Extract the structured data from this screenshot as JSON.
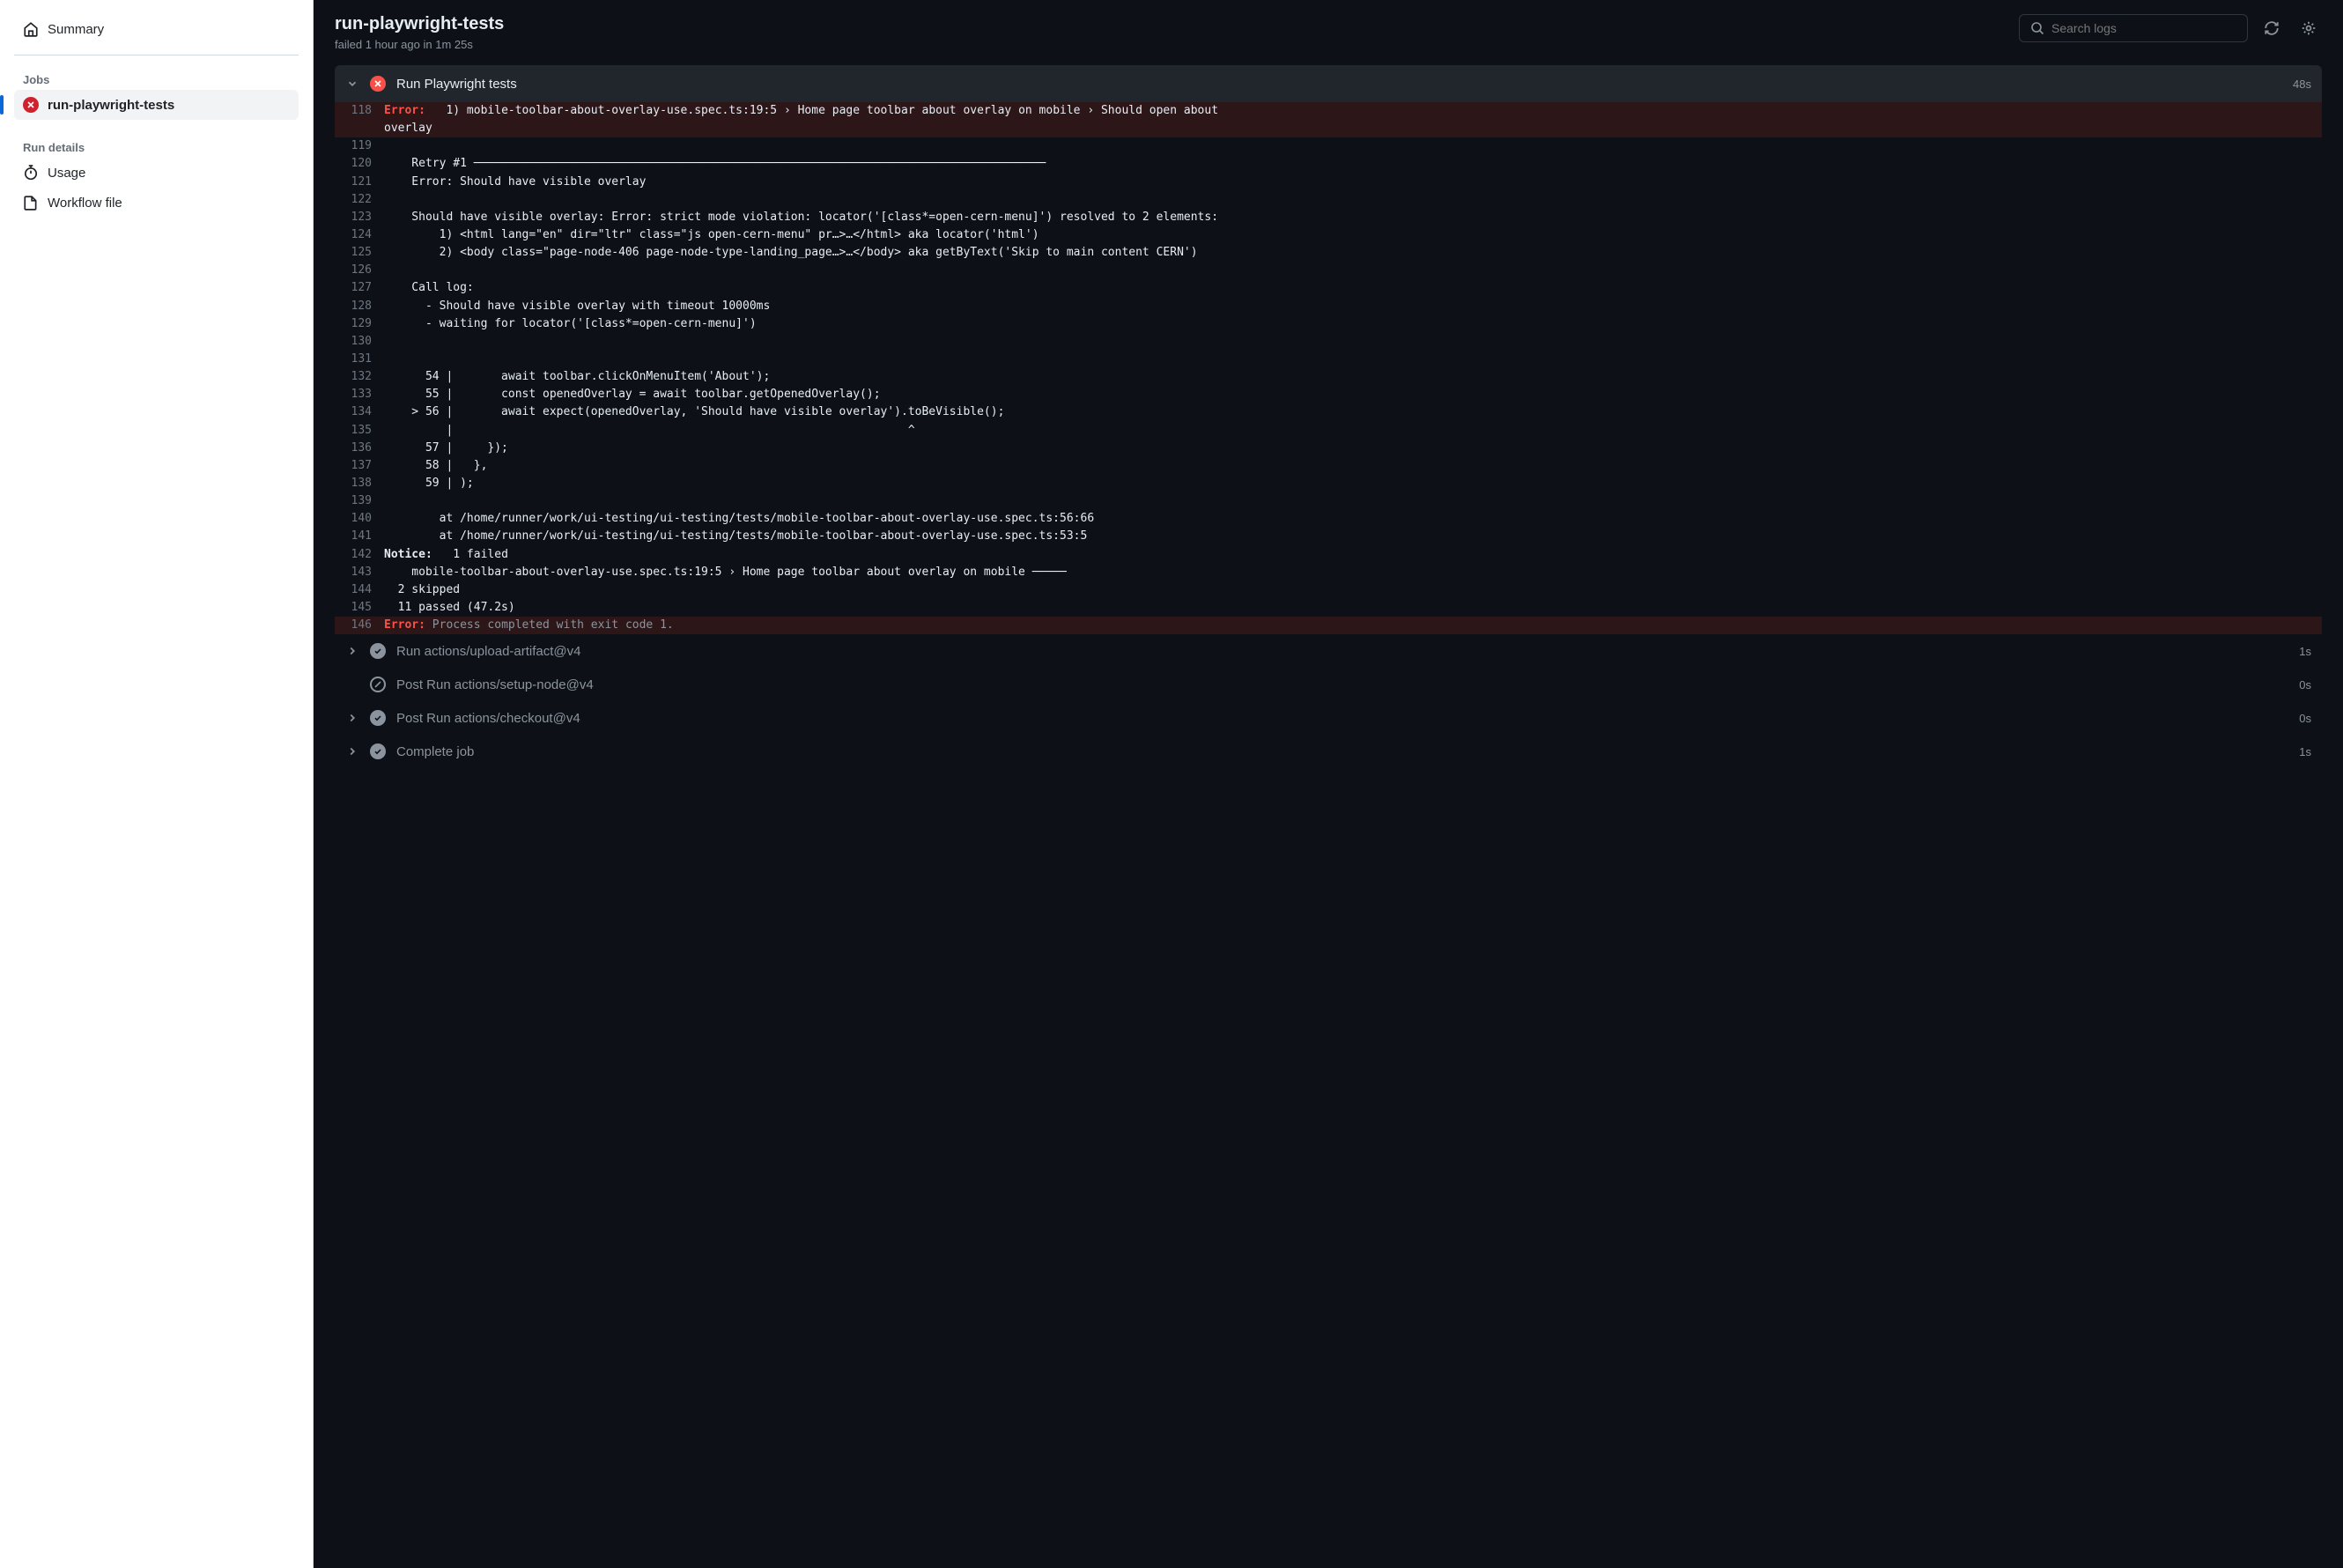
{
  "sidebar": {
    "summary": "Summary",
    "jobs_heading": "Jobs",
    "job_name": "run-playwright-tests",
    "run_details_heading": "Run details",
    "usage": "Usage",
    "workflow_file": "Workflow file"
  },
  "header": {
    "title": "run-playwright-tests",
    "status": "failed",
    "when": "1 hour ago",
    "in_word": "in",
    "duration": "1m 25s"
  },
  "search": {
    "placeholder": "Search logs"
  },
  "step_open": {
    "name": "Run Playwright tests",
    "duration": "48s"
  },
  "log": [
    {
      "n": "118",
      "err": true,
      "seg": [
        [
          "t-err",
          "Error:"
        ],
        [
          "",
          " "
        ],
        [
          "",
          "  1) mobile-toolbar-about-overlay-use.spec.ts:19:5 › Home page toolbar about overlay on mobile › Should open about"
        ]
      ]
    },
    {
      "n": "",
      "err": true,
      "seg": [
        [
          "",
          "overlay"
        ]
      ]
    },
    {
      "n": "119",
      "seg": [
        [
          "",
          ""
        ]
      ]
    },
    {
      "n": "120",
      "seg": [
        [
          "",
          "    Retry #1 ───────────────────────────────────────────────────────────────────────────────────"
        ]
      ]
    },
    {
      "n": "121",
      "seg": [
        [
          "",
          "    Error: Should have visible overlay"
        ]
      ]
    },
    {
      "n": "122",
      "seg": [
        [
          "",
          ""
        ]
      ]
    },
    {
      "n": "123",
      "seg": [
        [
          "",
          "    Should have visible overlay: Error: strict mode violation: locator('[class*=open-cern-menu]') resolved to 2 elements:"
        ]
      ]
    },
    {
      "n": "124",
      "seg": [
        [
          "",
          "        1) <html lang=\"en\" dir=\"ltr\" class=\"js open-cern-menu\" pr…>…</html> aka locator('html')"
        ]
      ]
    },
    {
      "n": "125",
      "seg": [
        [
          "",
          "        2) <body class=\"page-node-406 page-node-type-landing_page…>…</body> aka getByText('Skip to main content CERN')"
        ]
      ]
    },
    {
      "n": "126",
      "seg": [
        [
          "",
          ""
        ]
      ]
    },
    {
      "n": "127",
      "seg": [
        [
          "",
          "    Call log:"
        ]
      ]
    },
    {
      "n": "128",
      "seg": [
        [
          "",
          "      - Should have visible overlay with timeout 10000ms"
        ]
      ]
    },
    {
      "n": "129",
      "seg": [
        [
          "",
          "      - waiting for locator('[class*=open-cern-menu]')"
        ]
      ]
    },
    {
      "n": "130",
      "seg": [
        [
          "",
          ""
        ]
      ]
    },
    {
      "n": "131",
      "seg": [
        [
          "",
          ""
        ]
      ]
    },
    {
      "n": "132",
      "seg": [
        [
          "",
          "      54 |       await toolbar.clickOnMenuItem('About');"
        ]
      ]
    },
    {
      "n": "133",
      "seg": [
        [
          "",
          "      55 |       const openedOverlay = await toolbar.getOpenedOverlay();"
        ]
      ]
    },
    {
      "n": "134",
      "seg": [
        [
          "",
          "    > 56 |       await expect(openedOverlay, 'Should have visible overlay').toBeVisible();"
        ]
      ]
    },
    {
      "n": "135",
      "seg": [
        [
          "",
          "         |                                                                  ^"
        ]
      ]
    },
    {
      "n": "136",
      "seg": [
        [
          "",
          "      57 |     });"
        ]
      ]
    },
    {
      "n": "137",
      "seg": [
        [
          "",
          "      58 |   },"
        ]
      ]
    },
    {
      "n": "138",
      "seg": [
        [
          "",
          "      59 | );"
        ]
      ]
    },
    {
      "n": "139",
      "seg": [
        [
          "",
          ""
        ]
      ]
    },
    {
      "n": "140",
      "seg": [
        [
          "",
          "        at /home/runner/work/ui-testing/ui-testing/tests/mobile-toolbar-about-overlay-use.spec.ts:56:66"
        ]
      ]
    },
    {
      "n": "141",
      "seg": [
        [
          "",
          "        at /home/runner/work/ui-testing/ui-testing/tests/mobile-toolbar-about-overlay-use.spec.ts:53:5"
        ]
      ]
    },
    {
      "n": "142",
      "seg": [
        [
          "t-notice",
          "Notice:"
        ],
        [
          "",
          " "
        ],
        [
          "",
          "  1 failed"
        ]
      ]
    },
    {
      "n": "143",
      "seg": [
        [
          "",
          "    mobile-toolbar-about-overlay-use.spec.ts:19:5 › Home page toolbar about overlay on mobile ─────"
        ]
      ]
    },
    {
      "n": "144",
      "seg": [
        [
          "",
          "  2 skipped"
        ]
      ]
    },
    {
      "n": "145",
      "seg": [
        [
          "",
          "  11 passed (47.2s)"
        ]
      ]
    },
    {
      "n": "146",
      "err": true,
      "seg": [
        [
          "t-err",
          "Error:"
        ],
        [
          "",
          " "
        ],
        [
          "t-dim",
          "Process completed with exit code 1."
        ]
      ]
    }
  ],
  "steps_after": [
    {
      "chev": true,
      "status": "ok",
      "name": "Run actions/upload-artifact@v4",
      "dur": "1s"
    },
    {
      "chev": false,
      "status": "skip",
      "name": "Post Run actions/setup-node@v4",
      "dur": "0s"
    },
    {
      "chev": true,
      "status": "ok",
      "name": "Post Run actions/checkout@v4",
      "dur": "0s"
    },
    {
      "chev": true,
      "status": "ok",
      "name": "Complete job",
      "dur": "1s"
    }
  ]
}
